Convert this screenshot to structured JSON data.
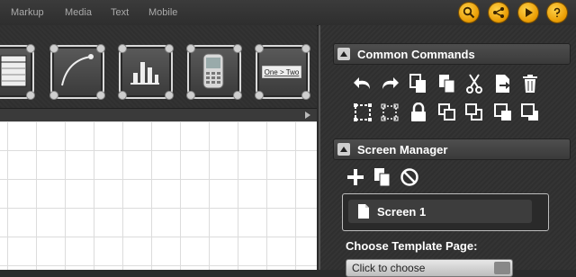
{
  "menu": {
    "items": [
      "Markup",
      "Media",
      "Text",
      "Mobile"
    ],
    "icons": [
      "search-icon",
      "share-icon",
      "play-icon",
      "help-icon"
    ]
  },
  "common_commands": {
    "title": "Common Commands",
    "row1_icons": [
      "undo-icon",
      "redo-icon",
      "copy-icon",
      "paste-icon",
      "cut-icon",
      "export-icon",
      "delete-icon"
    ],
    "row2_icons": [
      "group-icon",
      "ungroup-icon",
      "lock-icon",
      "bring-forward-icon",
      "send-backward-icon",
      "bring-to-front-icon",
      "send-to-back-icon"
    ]
  },
  "screen_manager": {
    "title": "Screen Manager",
    "tool_icons": [
      "add-icon",
      "duplicate-icon",
      "remove-icon"
    ],
    "screens": [
      "Screen 1"
    ],
    "template_label": "Choose Template Page:",
    "template_value": "Click to choose"
  },
  "colors": {
    "accent": "#f2b100",
    "panel_bg": "#333333",
    "canvas_bg": "#ffffff"
  }
}
